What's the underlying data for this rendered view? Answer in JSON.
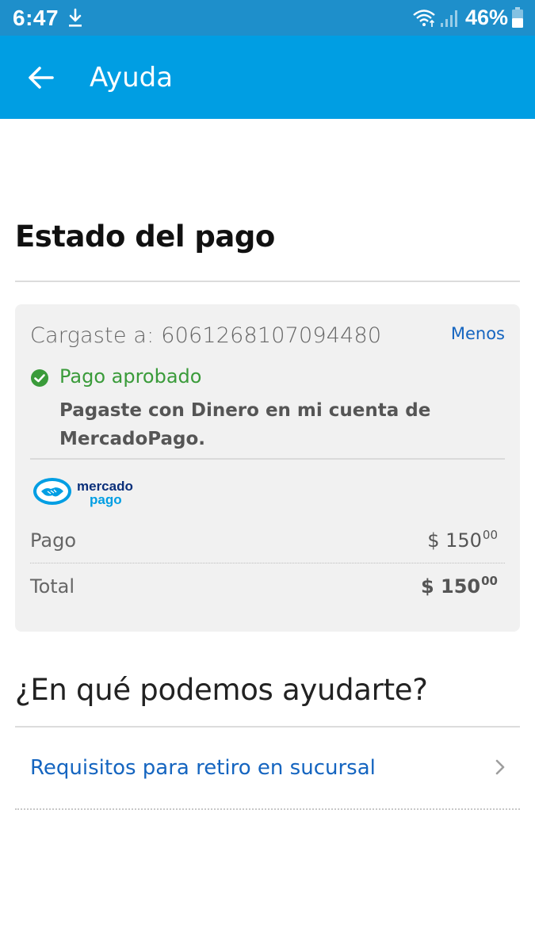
{
  "status_bar": {
    "time": "6:47",
    "battery_percent": "46%",
    "icons": [
      "download-icon",
      "wifi-icon",
      "signal-icon",
      "battery-icon"
    ]
  },
  "app_bar": {
    "title": "Ayuda",
    "back_icon": "arrow-left-icon",
    "color": "#009ee3"
  },
  "payment_status": {
    "section_title": "Estado del pago",
    "card": {
      "charged_to": "Cargaste a: 6061268107094480",
      "toggle_label": "Menos",
      "status": "Pago aprobado",
      "status_color": "#3a9b3a",
      "paid_with": "Pagaste con Dinero en mi cuenta de MercadoPago.",
      "logo": {
        "line1": "mercado",
        "line2": "pago"
      },
      "rows": [
        {
          "label": "Pago",
          "currency": "$ 150",
          "cents": "00"
        },
        {
          "label": "Total",
          "currency": "$ 150",
          "cents": "00"
        }
      ]
    }
  },
  "help": {
    "title": "¿En qué podemos ayudarte?",
    "items": [
      {
        "label": "Requisitos para retiro en sucursal"
      }
    ]
  }
}
